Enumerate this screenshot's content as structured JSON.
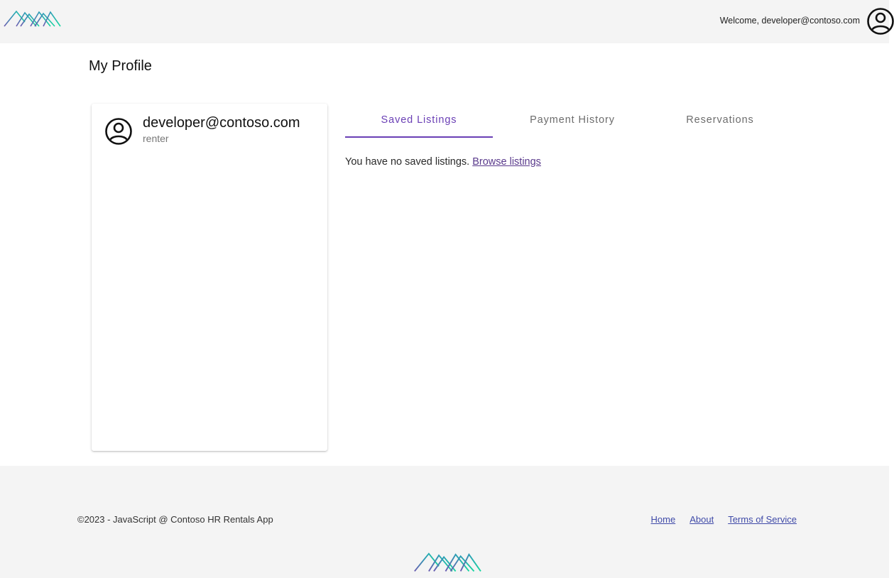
{
  "header": {
    "logo_icon": "mountains-logo-icon",
    "welcome_text": "Welcome, developer@contoso.com",
    "avatar_icon": "user-circle-icon"
  },
  "page": {
    "title": "My Profile"
  },
  "profile_card": {
    "avatar_icon": "user-circle-icon",
    "email": "developer@contoso.com",
    "role": "renter"
  },
  "tabs": [
    {
      "label": "Saved Listings",
      "active": true
    },
    {
      "label": "Payment History",
      "active": false
    },
    {
      "label": "Reservations",
      "active": false
    }
  ],
  "saved_listings": {
    "empty_message": "You have no saved listings.",
    "browse_link": "Browse listings"
  },
  "footer": {
    "copyright": "©2023 - JavaScript @ Contoso HR Rentals App",
    "links": [
      "Home",
      "About",
      "Terms of Service"
    ],
    "logo_icon": "mountains-logo-icon"
  },
  "colors": {
    "accent": "#6a3fb5",
    "logo_teal": "#1fb8a8",
    "logo_purple": "#6b5bb0",
    "header_bg": "#f4f4f4",
    "link": "#3f4aa8"
  }
}
